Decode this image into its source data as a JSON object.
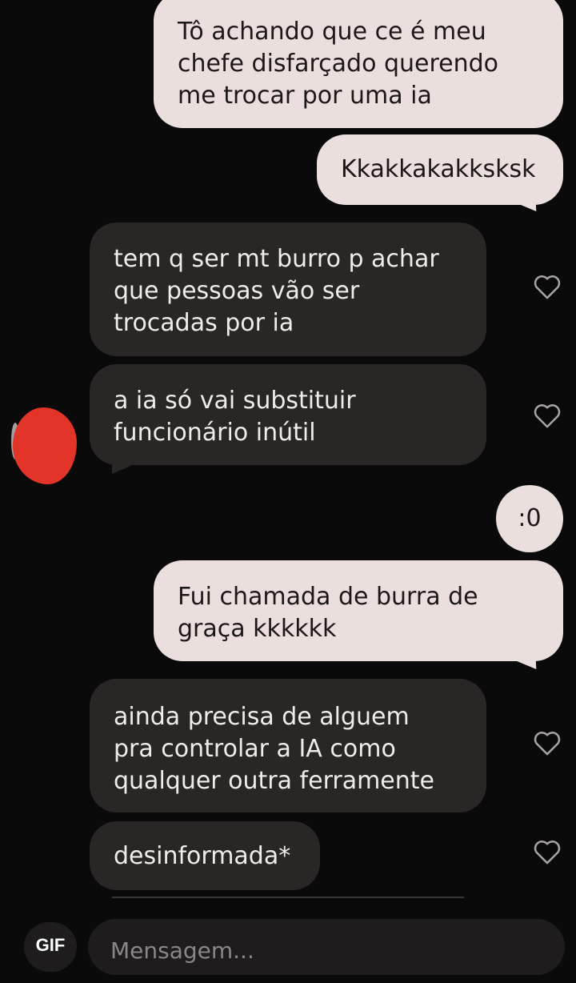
{
  "messages": [
    {
      "side": "sent",
      "text": "Tô achando que ce é meu\nchefe disfarçado querendo\nme trocar por uma ia"
    },
    {
      "side": "sent",
      "text": "Kkakkakakksksk"
    },
    {
      "side": "received",
      "text": "tem q ser mt burro p achar\nque pessoas vão ser\ntrocadas por ia"
    },
    {
      "side": "received",
      "text": "a ia só vai substituir\nfuncionário inútil"
    },
    {
      "side": "sent",
      "text": ":0"
    },
    {
      "side": "sent",
      "text": "Fui chamada de burra de\ngraça kkkkkk"
    },
    {
      "side": "received",
      "text": "ainda precisa de alguem\npra controlar a IA como\nqualquer outra ferramente"
    },
    {
      "side": "received",
      "text": "desinformada*"
    }
  ],
  "composer": {
    "gif_label": "GIF",
    "placeholder": "Mensagem..."
  },
  "colors": {
    "background": "#0b0a0a",
    "sent_bubble": "#ebdfdd",
    "received_bubble": "#2a2626",
    "avatar_redaction": "#e3342a"
  },
  "icons": {
    "like": "heart-outline-icon"
  }
}
